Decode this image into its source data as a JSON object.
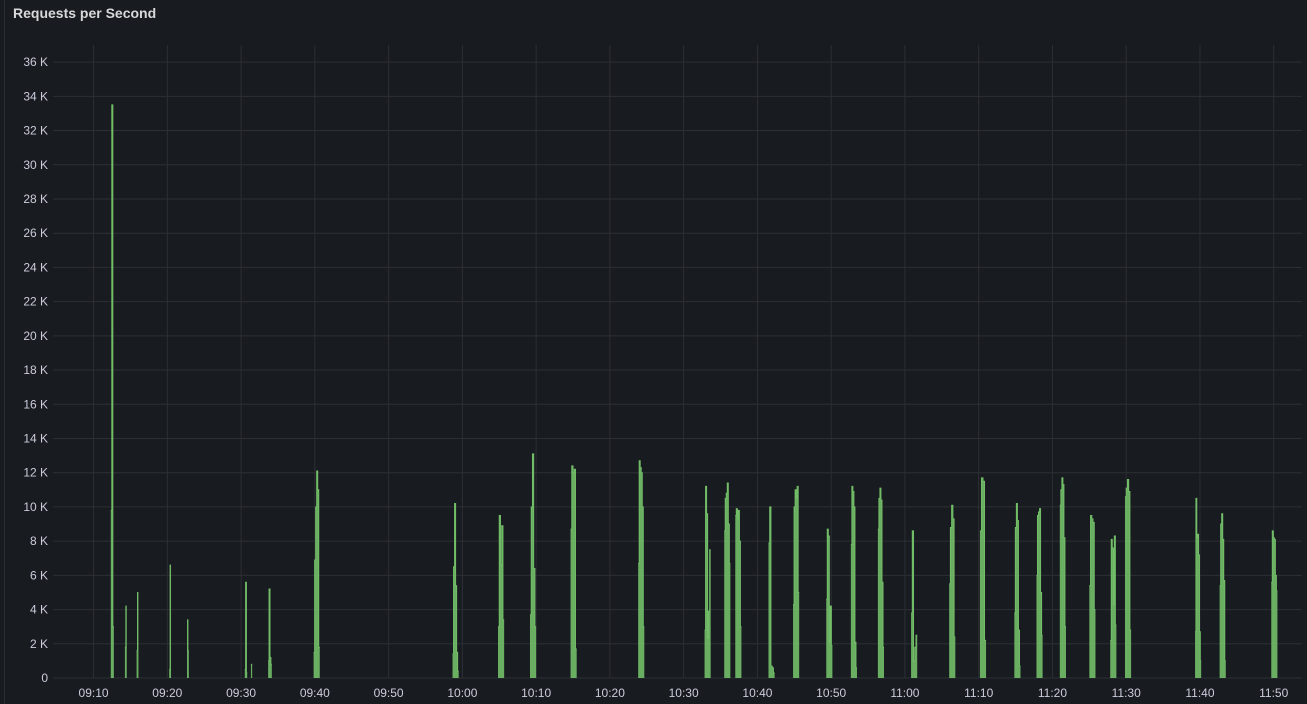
{
  "panel": {
    "title": "Requests per Second"
  },
  "colors": {
    "background": "#181b1f",
    "grid": "#2c2f35",
    "series": "#73bf69",
    "text": "#ccccdc"
  },
  "chart_data": {
    "type": "area",
    "title": "Requests per Second",
    "xlabel": "",
    "ylabel": "",
    "grid": true,
    "legend": "none",
    "ylim": [
      0,
      37000
    ],
    "y_ticks": [
      0,
      2000,
      4000,
      6000,
      8000,
      10000,
      12000,
      14000,
      16000,
      18000,
      20000,
      22000,
      24000,
      26000,
      28000,
      30000,
      32000,
      34000,
      36000
    ],
    "y_tick_labels": [
      "0",
      "2 K",
      "4 K",
      "6 K",
      "8 K",
      "10 K",
      "12 K",
      "14 K",
      "16 K",
      "18 K",
      "20 K",
      "22 K",
      "24 K",
      "26 K",
      "28 K",
      "30 K",
      "32 K",
      "34 K",
      "36 K"
    ],
    "x_range": [
      "09:04:30",
      "11:53:50"
    ],
    "x_ticks": [
      "09:10",
      "09:20",
      "09:30",
      "09:40",
      "09:50",
      "10:00",
      "10:10",
      "10:20",
      "10:30",
      "10:40",
      "10:50",
      "11:00",
      "11:10",
      "11:20",
      "11:30",
      "11:40",
      "11:50"
    ],
    "series": [
      {
        "name": "",
        "color": "#73bf69",
        "bursts": [
          {
            "start": "09:12:20",
            "end": "09:12:45",
            "values": [
              9800,
              33500,
              3000
            ]
          },
          {
            "start": "09:14:15",
            "end": "09:14:30",
            "values": [
              1800,
              4200
            ]
          },
          {
            "start": "09:15:50",
            "end": "09:16:05",
            "values": [
              1600,
              5000
            ]
          },
          {
            "start": "09:20:15",
            "end": "09:20:30",
            "values": [
              500,
              6600
            ]
          },
          {
            "start": "09:22:40",
            "end": "09:22:55",
            "values": [
              3400,
              1600
            ]
          },
          {
            "start": "09:30:30",
            "end": "09:30:50",
            "values": [
              500,
              5600,
              300
            ]
          },
          {
            "start": "09:31:20",
            "end": "09:31:30",
            "values": [
              800
            ]
          },
          {
            "start": "09:33:40",
            "end": "09:34:10",
            "values": [
              1000,
              5200,
              1200,
              800
            ]
          },
          {
            "start": "09:39:50",
            "end": "09:40:40",
            "values": [
              1500,
              6900,
              10000,
              12100,
              11000,
              1800
            ]
          },
          {
            "start": "09:58:40",
            "end": "09:59:30",
            "values": [
              1400,
              6500,
              10200,
              5400,
              1500,
              400
            ]
          },
          {
            "start": "10:04:50",
            "end": "10:05:40",
            "values": [
              3000,
              9500,
              6600,
              8900,
              3400
            ]
          },
          {
            "start": "10:09:10",
            "end": "10:10:00",
            "values": [
              3700,
              10000,
              13100,
              6400,
              3000
            ]
          },
          {
            "start": "10:14:40",
            "end": "10:15:30",
            "values": [
              8700,
              12400,
              12000,
              12200,
              1700
            ]
          },
          {
            "start": "10:23:50",
            "end": "10:24:40",
            "values": [
              6700,
              12700,
              12300,
              12000,
              10000,
              3000
            ]
          },
          {
            "start": "10:32:50",
            "end": "10:33:40",
            "values": [
              2800,
              11200,
              9600,
              2300,
              3900,
              7500
            ]
          },
          {
            "start": "10:35:30",
            "end": "10:36:20",
            "values": [
              8600,
              10500,
              10800,
              11400,
              9000,
              6700
            ]
          },
          {
            "start": "10:37:00",
            "end": "10:37:50",
            "values": [
              9500,
              9900,
              9300,
              9800,
              8000,
              3000
            ]
          },
          {
            "start": "10:41:30",
            "end": "10:42:20",
            "values": [
              7900,
              10000,
              700,
              600,
              300
            ]
          },
          {
            "start": "10:44:50",
            "end": "10:45:40",
            "values": [
              4300,
              10000,
              11000,
              10500,
              11200,
              5000
            ]
          },
          {
            "start": "10:49:20",
            "end": "10:50:10",
            "values": [
              4600,
              8700,
              8300,
              2100,
              4200,
              1900
            ]
          },
          {
            "start": "10:52:40",
            "end": "10:53:30",
            "values": [
              7800,
              11200,
              10900,
              10000,
              2100,
              600
            ]
          },
          {
            "start": "10:56:20",
            "end": "10:57:10",
            "values": [
              8700,
              10500,
              11100,
              10400,
              5600,
              1800
            ]
          },
          {
            "start": "11:00:50",
            "end": "11:01:40",
            "values": [
              3800,
              8600,
              1000,
              1800,
              2500
            ]
          },
          {
            "start": "11:06:00",
            "end": "11:06:50",
            "values": [
              5500,
              8800,
              10100,
              9300,
              2400
            ]
          },
          {
            "start": "11:10:10",
            "end": "11:11:00",
            "values": [
              8600,
              11700,
              11500,
              2200
            ]
          },
          {
            "start": "11:14:50",
            "end": "11:15:40",
            "values": [
              3800,
              8800,
              10200,
              9200,
              2800,
              700
            ]
          },
          {
            "start": "11:17:50",
            "end": "11:18:40",
            "values": [
              6000,
              9500,
              9700,
              9900,
              5000,
              2500
            ]
          },
          {
            "start": "11:21:00",
            "end": "11:21:50",
            "values": [
              10100,
              11000,
              11700,
              11300,
              8200,
              3000
            ]
          },
          {
            "start": "11:25:00",
            "end": "11:25:50",
            "values": [
              5400,
              9500,
              9300,
              9100,
              4000
            ]
          },
          {
            "start": "11:27:50",
            "end": "11:28:40",
            "values": [
              2200,
              8100,
              7600,
              4300,
              8300,
              3100
            ]
          },
          {
            "start": "11:29:50",
            "end": "11:30:40",
            "values": [
              10600,
              11100,
              11600,
              10900,
              2800
            ]
          },
          {
            "start": "11:39:20",
            "end": "11:40:10",
            "values": [
              2700,
              10500,
              8200,
              8400,
              7200,
              2700,
              1000
            ]
          },
          {
            "start": "11:42:40",
            "end": "11:43:30",
            "values": [
              5400,
              9000,
              9600,
              8100,
              5700,
              1000
            ]
          },
          {
            "start": "11:49:40",
            "end": "11:50:30",
            "values": [
              5600,
              8600,
              8200,
              8100,
              6000,
              5100
            ]
          }
        ]
      }
    ]
  }
}
